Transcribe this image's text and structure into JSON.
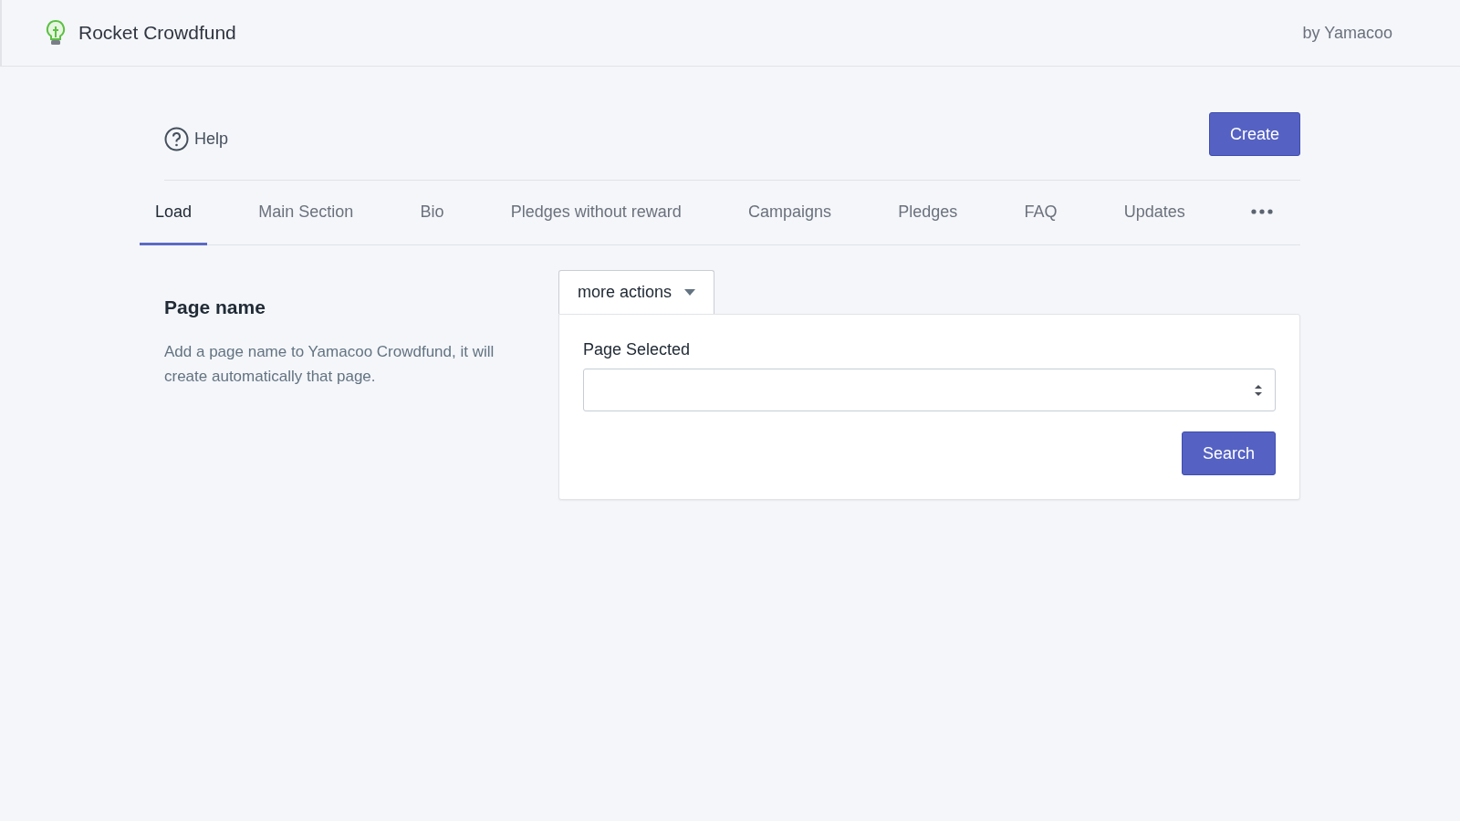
{
  "header": {
    "app_name": "Rocket Crowdfund",
    "byline": "by Yamacoo"
  },
  "toolbar": {
    "help": "Help",
    "create_button": "Create"
  },
  "tabs": [
    {
      "label": "Load",
      "selected": true
    },
    {
      "label": "Main Section",
      "selected": false
    },
    {
      "label": "Bio",
      "selected": false
    },
    {
      "label": "Pledges without reward",
      "selected": false
    },
    {
      "label": "Campaigns",
      "selected": false
    },
    {
      "label": "Pledges",
      "selected": false
    },
    {
      "label": "FAQ",
      "selected": false
    },
    {
      "label": "Updates",
      "selected": false
    }
  ],
  "section": {
    "title": "Page name",
    "description": "Add a page name to Yamacoo Crowdfund, it will create automatically that page."
  },
  "actions_button": "more actions",
  "form": {
    "field_label": "Page Selected",
    "search_button": "Search"
  }
}
